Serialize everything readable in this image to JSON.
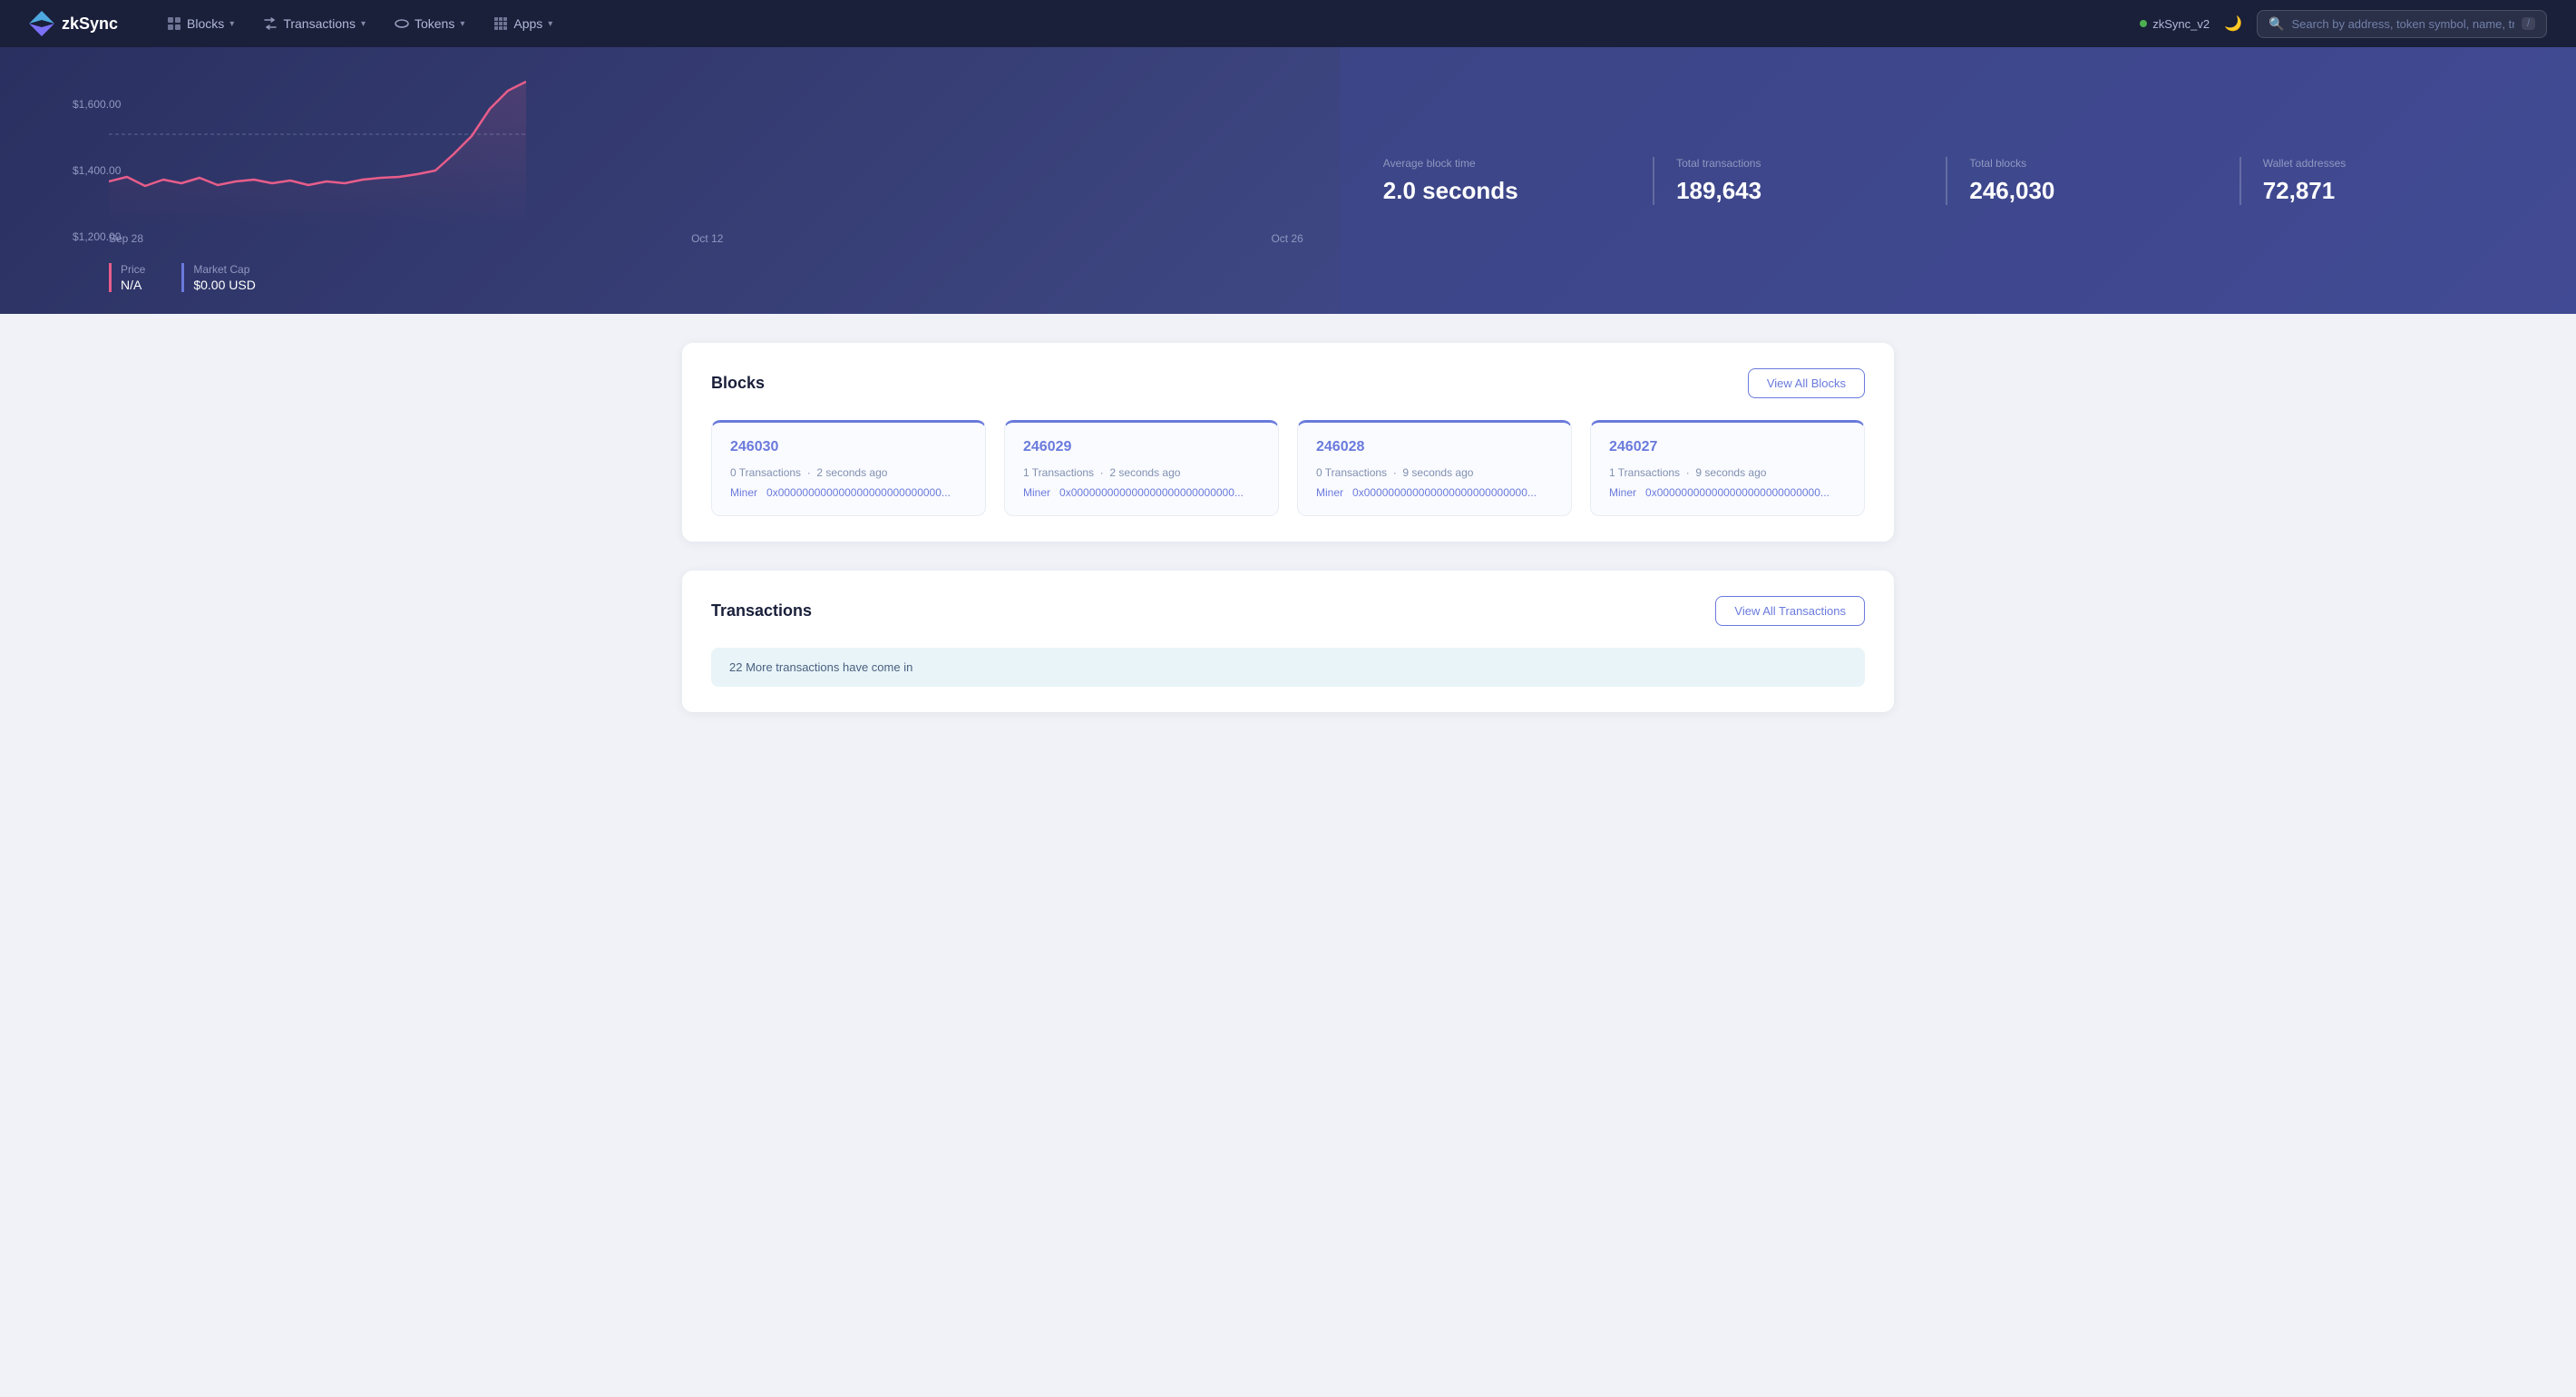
{
  "navbar": {
    "logo_text": "zkSync",
    "nav_items": [
      {
        "label": "Blocks",
        "icon": "blocks-icon"
      },
      {
        "label": "Transactions",
        "icon": "transactions-icon"
      },
      {
        "label": "Tokens",
        "icon": "tokens-icon"
      },
      {
        "label": "Apps",
        "icon": "apps-icon"
      }
    ],
    "network": "zkSync_v2",
    "search_placeholder": "Search by address, token symbol, name, transact...",
    "kbd_hint": "/"
  },
  "hero": {
    "chart": {
      "y_labels": [
        "$1,600.00",
        "$1,400.00",
        "$1,200.00"
      ],
      "x_labels": [
        "Sep 28",
        "Oct 12",
        "Oct 26"
      ],
      "price_label": "Price",
      "price_value": "N/A",
      "market_cap_label": "Market Cap",
      "market_cap_value": "$0.00 USD"
    },
    "stats": [
      {
        "label": "Average block time",
        "value": "2.0 seconds"
      },
      {
        "label": "Total transactions",
        "value": "189,643"
      },
      {
        "label": "Total blocks",
        "value": "246,030"
      },
      {
        "label": "Wallet addresses",
        "value": "72,871"
      }
    ]
  },
  "blocks_section": {
    "title": "Blocks",
    "view_all_label": "View All Blocks",
    "blocks": [
      {
        "number": "246030",
        "transactions": "0 Transactions",
        "time": "2 seconds ago",
        "miner_label": "Miner",
        "miner_address": "0x000000000000000000000000000..."
      },
      {
        "number": "246029",
        "transactions": "1 Transactions",
        "time": "2 seconds ago",
        "miner_label": "Miner",
        "miner_address": "0x000000000000000000000000000..."
      },
      {
        "number": "246028",
        "transactions": "0 Transactions",
        "time": "9 seconds ago",
        "miner_label": "Miner",
        "miner_address": "0x000000000000000000000000000..."
      },
      {
        "number": "246027",
        "transactions": "1 Transactions",
        "time": "9 seconds ago",
        "miner_label": "Miner",
        "miner_address": "0x000000000000000000000000000..."
      }
    ]
  },
  "transactions_section": {
    "title": "Transactions",
    "view_all_label": "View All Transactions",
    "notice": "22 More transactions have come in"
  },
  "colors": {
    "accent": "#6a7adc",
    "brand": "#e85d8a",
    "dark_bg": "#1a1f3a",
    "hero_bg": "#2a3060",
    "text_muted": "#9098c0"
  }
}
